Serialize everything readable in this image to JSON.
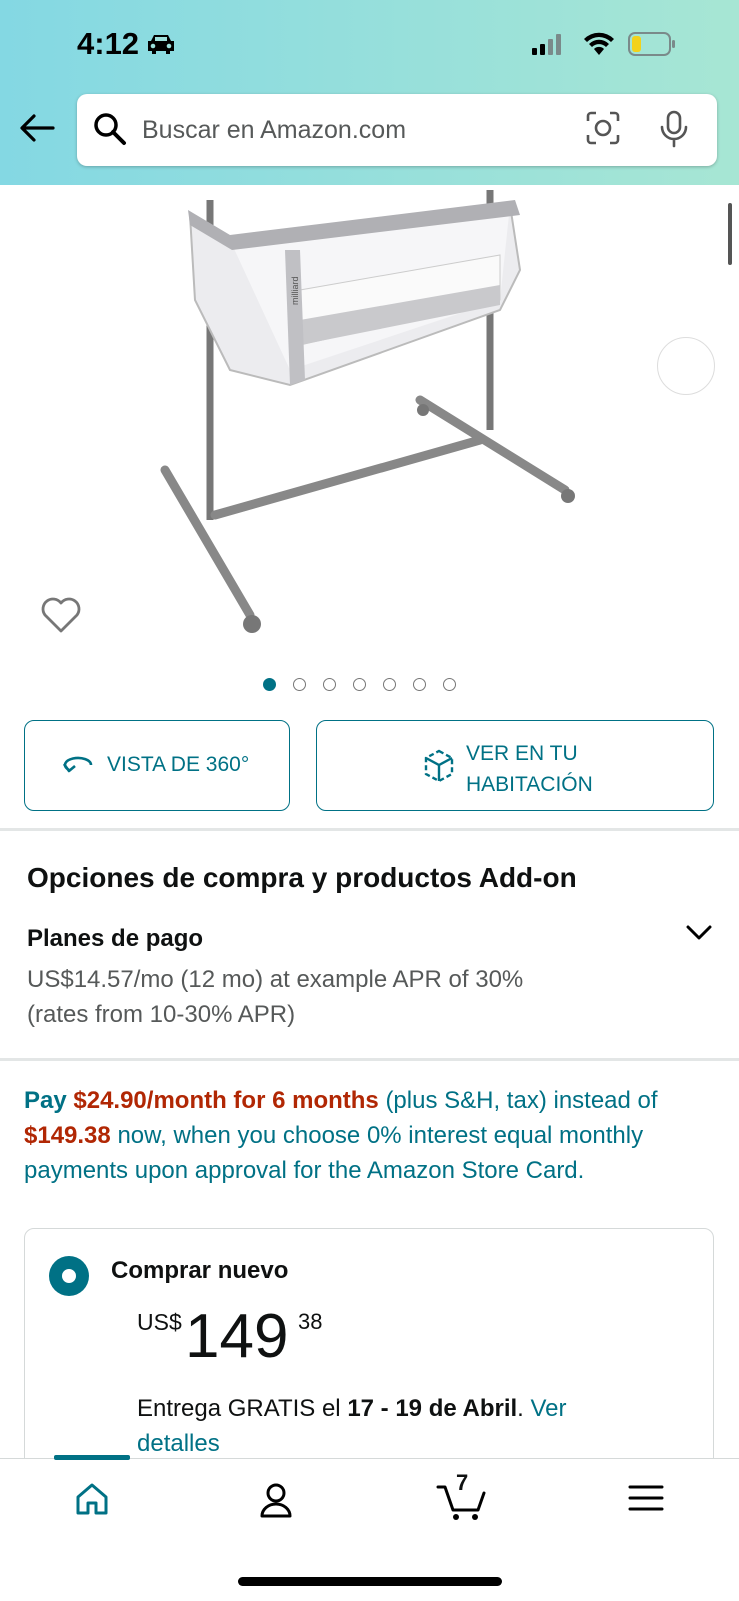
{
  "status_bar": {
    "time": "4:12",
    "icons": [
      "car-icon",
      "cellular-signal-icon",
      "wifi-icon",
      "battery-icon"
    ]
  },
  "search": {
    "placeholder": "Buscar en Amazon.com",
    "icons": [
      "back-arrow-icon",
      "search-icon",
      "camera-lens-icon",
      "microphone-icon"
    ]
  },
  "gallery": {
    "image_count": 7,
    "active_index": 0,
    "image_text": "milliard"
  },
  "view_buttons": {
    "view_360": "VISTA DE 360°",
    "view_room": "VER EN TU HABITACIÓN"
  },
  "options": {
    "title": "Opciones de compra y productos Add-on",
    "plan_title": "Planes de pago",
    "plan_line1": "US$14.57/mo (12 mo) at example APR of 30%",
    "plan_line2": "(rates from 10-30% APR)"
  },
  "promo": {
    "pay": "Pay",
    "monthly": "$24.90/month for 6 months",
    "mid": "(plus S&H, tax) instead of",
    "price": "$149.38",
    "rest": "now, when you choose 0% interest equal monthly payments upon approval for the Amazon Store Card."
  },
  "buy_box": {
    "label": "Comprar nuevo",
    "currency": "US$",
    "price_whole": "149",
    "price_fraction": "38",
    "delivery_prefix": "Entrega GRATIS el",
    "delivery_dates": "17 - 19 de Abril",
    "details_link": "Ver detalles"
  },
  "tab_bar": {
    "tabs": [
      "home-icon",
      "account-icon",
      "cart-icon",
      "menu-icon"
    ],
    "active_tab": "home",
    "cart_count": "7"
  },
  "colors": {
    "accent": "#007185",
    "price_red": "#B12704",
    "header_gradient_start": "#84d8e3",
    "header_gradient_end": "#a7e6d4"
  }
}
